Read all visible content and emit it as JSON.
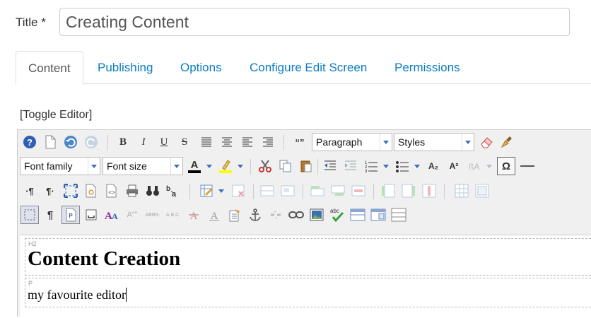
{
  "form": {
    "title_label": "Title *",
    "title_value": "Creating Content"
  },
  "tabs": [
    {
      "label": "Content",
      "active": true
    },
    {
      "label": "Publishing",
      "active": false
    },
    {
      "label": "Options",
      "active": false
    },
    {
      "label": "Configure Edit Screen",
      "active": false
    },
    {
      "label": "Permissions",
      "active": false
    }
  ],
  "toggle_editor": "[Toggle Editor]",
  "toolbar": {
    "format_select": "Paragraph",
    "styles_select": "Styles",
    "font_family_select": "Font family",
    "font_size_select": "Font size",
    "subscript_label": "A₂",
    "superscript_label": "A²",
    "omega": "Ω",
    "pilcrow": "¶",
    "abbr_label": "ABBR.",
    "acronym_label": "A.B.C.",
    "quote_label": "«»",
    "cite_label": "“”",
    "text_color": "#000000",
    "highlight_color": "#ffff00"
  },
  "editor_content": {
    "heading_tag": "H2",
    "heading_text": "Content Creation",
    "para_tag": "P",
    "para_text": "my favourite editor"
  },
  "colors": {
    "link": "#0b7dc0",
    "toolbar_bg": "#f0f0f0"
  }
}
